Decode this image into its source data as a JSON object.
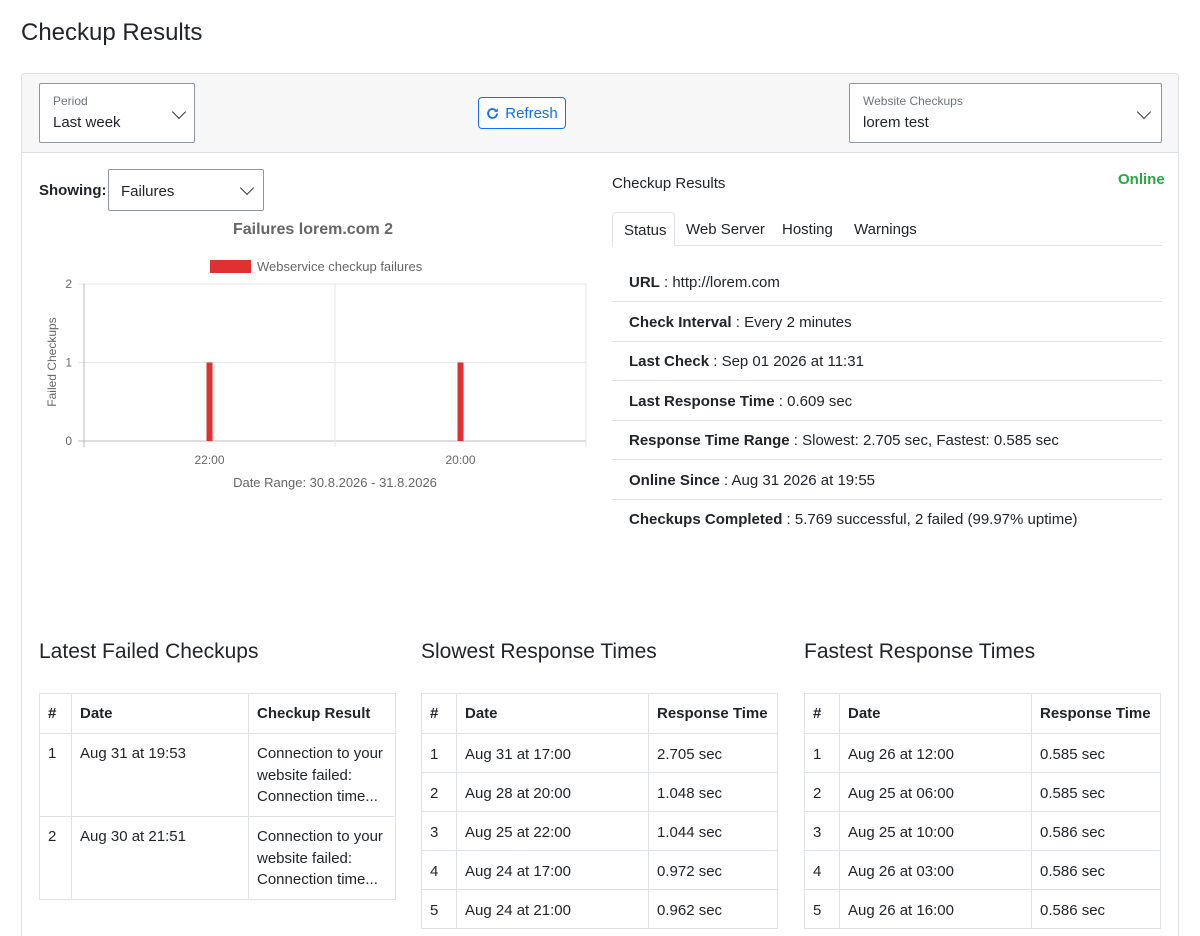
{
  "page_title": "Checkup Results",
  "header": {
    "period_label": "Period",
    "period_value": "Last week",
    "refresh_label": "Refresh",
    "website_label": "Website Checkups",
    "website_value": "lorem test"
  },
  "showing": {
    "label": "Showing:",
    "value": "Failures"
  },
  "chart_data": {
    "type": "bar",
    "title": "Failures lorem.com 2",
    "categories": [
      "22:00",
      "20:00"
    ],
    "series": [
      {
        "name": "Webservice checkup failures",
        "values": [
          1,
          1
        ],
        "color": "#e03030"
      }
    ],
    "xlabel": "Date Range: 30.8.2026 - 31.8.2026",
    "ylabel": "Failed Checkups",
    "yticks": [
      "2",
      "1",
      "0"
    ],
    "ylim": [
      0,
      2
    ],
    "grid": true,
    "legend": "top"
  },
  "results": {
    "title": "Checkup Results",
    "status": "Online",
    "tabs": [
      "Status",
      "Web Server",
      "Hosting",
      "Warnings"
    ],
    "rows": [
      {
        "key": "URL",
        "value": "http://lorem.com"
      },
      {
        "key": "Check Interval",
        "value": "Every 2 minutes"
      },
      {
        "key": "Last Check",
        "value": "Sep 01 2026 at 11:31"
      },
      {
        "key": "Last Response Time",
        "value": "0.609 sec"
      },
      {
        "key": "Response Time Range",
        "value": "Slowest: 2.705 sec, Fastest: 0.585 sec"
      },
      {
        "key": "Online Since",
        "value": "Aug 31 2026 at 19:55"
      },
      {
        "key": "Checkups Completed",
        "value": "5.769 successful, 2 failed (99.97% uptime)"
      }
    ]
  },
  "failed": {
    "title": "Latest Failed Checkups",
    "headers": [
      "#",
      "Date",
      "Checkup Result"
    ],
    "rows": [
      [
        "1",
        "Aug 31 at 19:53",
        "Connection to your website failed: Connection time..."
      ],
      [
        "2",
        "Aug 30 at 21:51",
        "Connection to your website failed: Connection time..."
      ]
    ]
  },
  "slowest": {
    "title": "Slowest Response Times",
    "headers": [
      "#",
      "Date",
      "Response Time"
    ],
    "rows": [
      [
        "1",
        "Aug 31 at 17:00",
        "2.705 sec"
      ],
      [
        "2",
        "Aug 28 at 20:00",
        "1.048 sec"
      ],
      [
        "3",
        "Aug 25 at 22:00",
        "1.044 sec"
      ],
      [
        "4",
        "Aug 24 at 17:00",
        "0.972 sec"
      ],
      [
        "5",
        "Aug 24 at 21:00",
        "0.962 sec"
      ]
    ]
  },
  "fastest": {
    "title": "Fastest Response Times",
    "headers": [
      "#",
      "Date",
      "Response Time"
    ],
    "rows": [
      [
        "1",
        "Aug 26 at 12:00",
        "0.585 sec"
      ],
      [
        "2",
        "Aug 25 at 06:00",
        "0.585 sec"
      ],
      [
        "3",
        "Aug 25 at 10:00",
        "0.586 sec"
      ],
      [
        "4",
        "Aug 26 at 03:00",
        "0.586 sec"
      ],
      [
        "5",
        "Aug 26 at 16:00",
        "0.586 sec"
      ]
    ]
  }
}
